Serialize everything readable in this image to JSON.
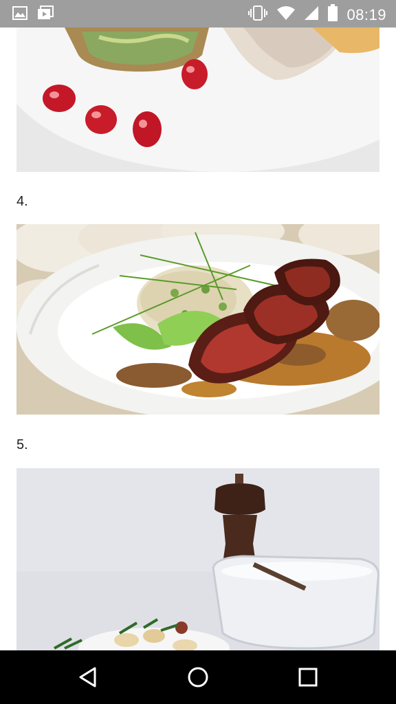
{
  "status_bar": {
    "time": "08:19",
    "left_icons": [
      "gallery-icon",
      "video-icon"
    ],
    "right_icons": [
      "vibrate-icon",
      "wifi-icon",
      "signal-icon",
      "battery-icon"
    ]
  },
  "article": {
    "items": [
      {
        "number": "4."
      },
      {
        "number": "5."
      }
    ]
  },
  "nav_bar": {
    "buttons": [
      "back-icon",
      "home-icon",
      "recents-icon"
    ]
  },
  "colors": {
    "status_bar_bg": "#9e9e9e",
    "nav_bar_bg": "#000000",
    "page_bg": "#ffffff"
  }
}
